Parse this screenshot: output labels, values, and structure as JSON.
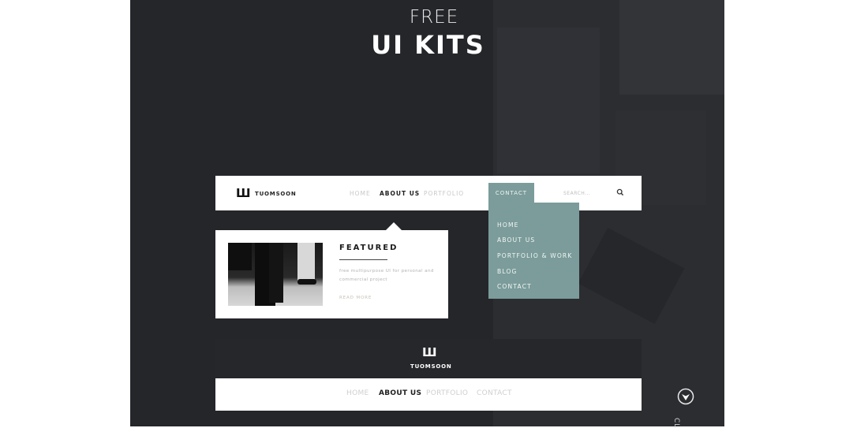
{
  "hero": {
    "free_label": "FREE",
    "title": "UI KITS"
  },
  "brand": {
    "logo_mark": "Ш",
    "name": "TUOMSOON"
  },
  "navbar": {
    "links": [
      {
        "label": "HOME",
        "active": false
      },
      {
        "label": "ABOUT US",
        "active": true
      },
      {
        "label": "PORTFOLIO",
        "active": false
      },
      {
        "label": "CONTACT",
        "active": false,
        "highlighted": true
      }
    ],
    "search_placeholder": "SEARCH...",
    "search_icon": "search-icon"
  },
  "dropdown": {
    "items": [
      "HOME",
      "ABOUT US",
      "PORTFOLIO & WORK",
      "BLOG",
      "CONTACT"
    ]
  },
  "featured_card": {
    "title": "FEATURED",
    "description": "free multipurpose UI for personal and commercial project",
    "read_more": "READ MORE"
  },
  "footer": {
    "links": [
      {
        "label": "HOME",
        "active": false
      },
      {
        "label": "ABOUT US",
        "active": true
      },
      {
        "label": "PORTFOLIO",
        "active": false
      },
      {
        "label": "CONTACT",
        "active": false
      }
    ]
  },
  "scroll": {
    "icon": "scroll-down-icon",
    "label": "CL"
  },
  "colors": {
    "panel_bg": "#25262a",
    "accent_teal": "#7b9c9a",
    "white": "#ffffff",
    "inactive_link": "#c8c8c8"
  }
}
